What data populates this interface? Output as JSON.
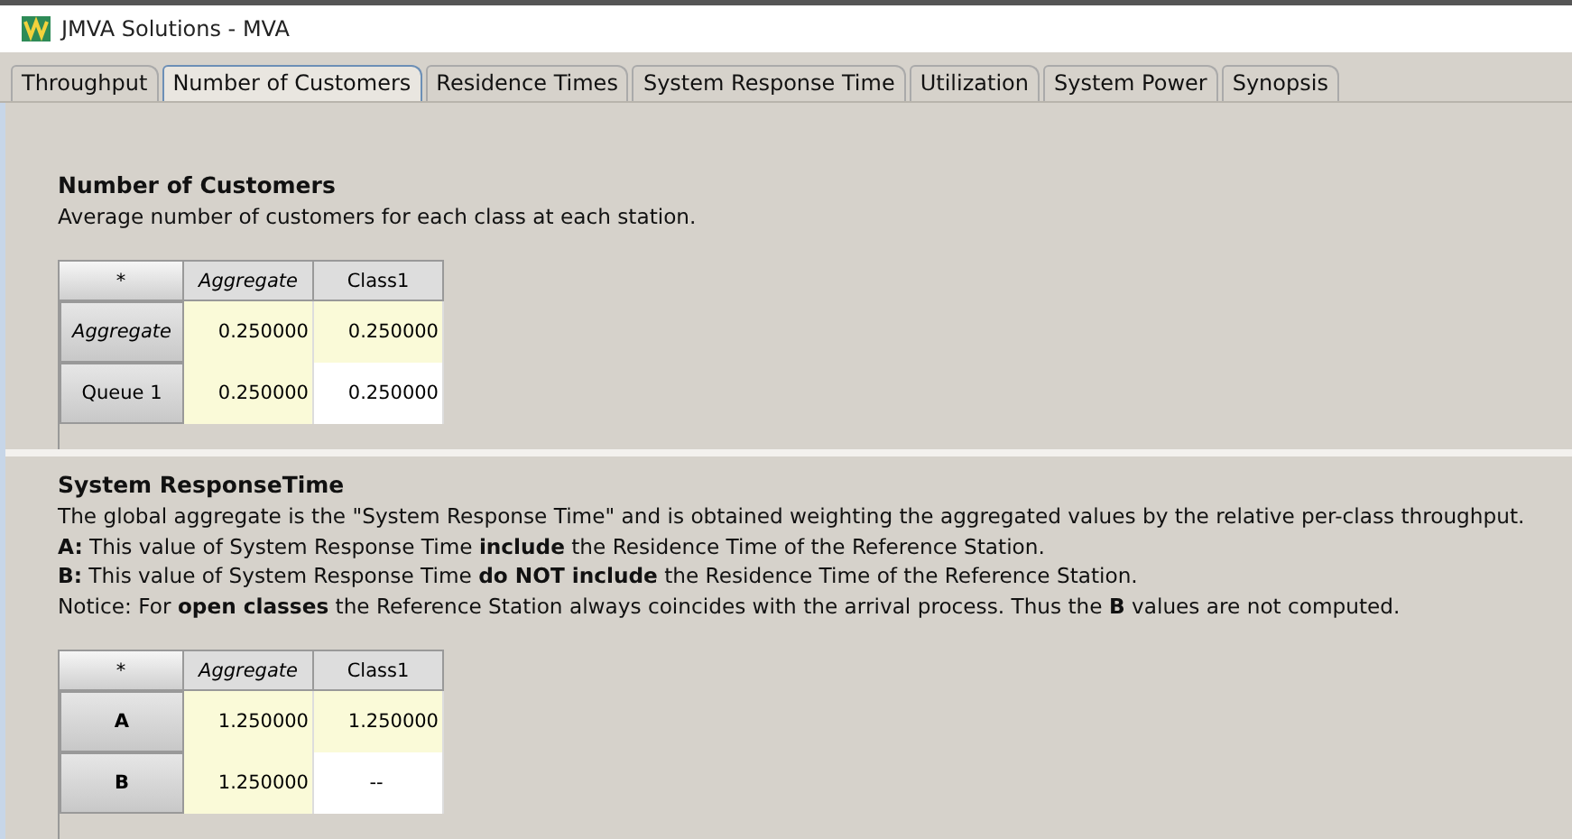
{
  "window": {
    "title": "JMVA Solutions - MVA"
  },
  "tabs": [
    {
      "label": "Throughput",
      "selected": false
    },
    {
      "label": "Number of Customers",
      "selected": true
    },
    {
      "label": "Residence Times",
      "selected": false
    },
    {
      "label": "System Response Time",
      "selected": false
    },
    {
      "label": "Utilization",
      "selected": false
    },
    {
      "label": "System Power",
      "selected": false
    },
    {
      "label": "Synopsis",
      "selected": false
    }
  ],
  "sections": [
    {
      "title": "Number of Customers",
      "lines": [
        "Average number of customers for each class at each station."
      ],
      "table": {
        "corner": "*",
        "columns": [
          {
            "label": "Aggregate",
            "kind": "aggregate"
          },
          {
            "label": "Class1",
            "kind": "class"
          }
        ],
        "rows": [
          {
            "header": "Aggregate",
            "kind": "aggregate",
            "cells": [
              {
                "text": "0.250000",
                "kind": "value",
                "highlighted": true
              },
              {
                "text": "0.250000",
                "kind": "value",
                "highlighted": true
              }
            ]
          },
          {
            "header": "Queue 1",
            "kind": "station",
            "cells": [
              {
                "text": "0.250000",
                "kind": "value",
                "highlighted": true
              },
              {
                "text": "0.250000",
                "kind": "value",
                "highlighted": false
              }
            ]
          }
        ]
      }
    },
    {
      "title": "System ResponseTime",
      "lines": [
        "The global aggregate is the \"System Response Time\" and is obtained weighting the aggregated values by the relative per-class throughput.",
        "**A:** This value of System Response Time **include** the Residence Time of the Reference Station.",
        "**B:** This value of System Response Time **do NOT include** the Residence Time of the Reference Station.",
        "Notice: For **open classes** the Reference Station always coincides with the arrival process. Thus the **B** values are not computed."
      ],
      "table": {
        "corner": "*",
        "columns": [
          {
            "label": "Aggregate",
            "kind": "aggregate"
          },
          {
            "label": "Class1",
            "kind": "class"
          }
        ],
        "rows": [
          {
            "header": "A",
            "kind": "measure",
            "cells": [
              {
                "text": "1.250000",
                "kind": "value",
                "highlighted": true
              },
              {
                "text": "1.250000",
                "kind": "value",
                "highlighted": true
              }
            ]
          },
          {
            "header": "B",
            "kind": "measure",
            "cells": [
              {
                "text": "1.250000",
                "kind": "value",
                "highlighted": true
              },
              {
                "text": "--",
                "kind": "missing",
                "highlighted": false
              }
            ]
          }
        ]
      }
    }
  ]
}
